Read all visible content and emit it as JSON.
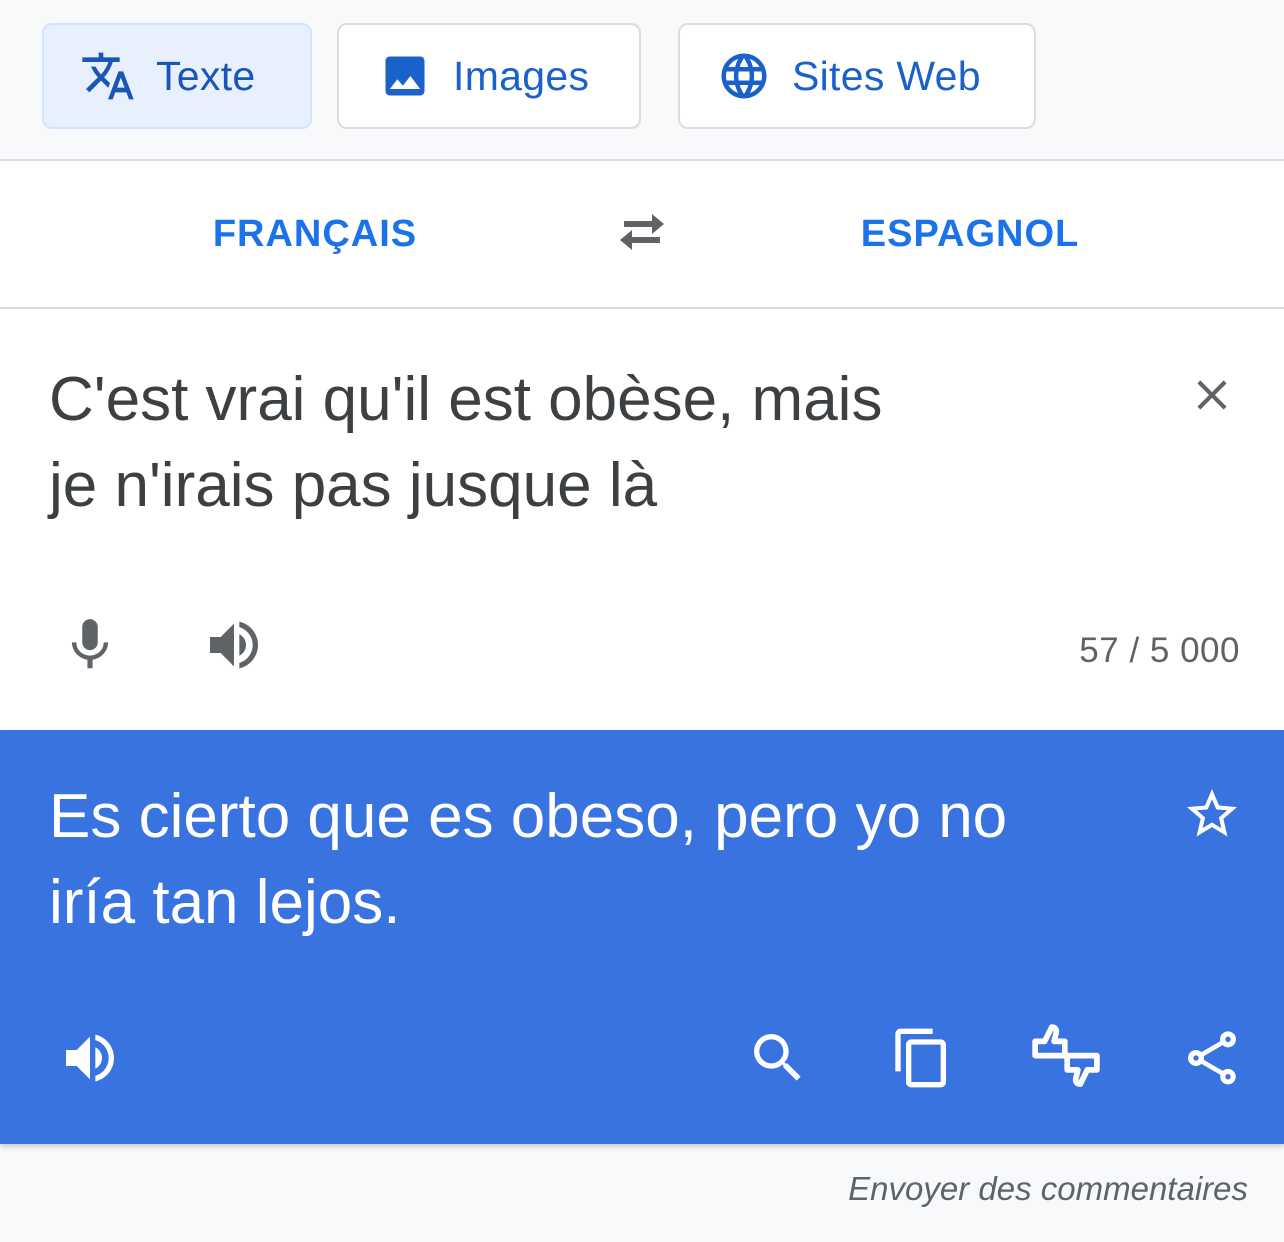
{
  "modes": {
    "text": {
      "label": "Texte",
      "icon": "translate-icon",
      "active": true
    },
    "images": {
      "label": "Images",
      "icon": "image-icon"
    },
    "sites": {
      "label": "Sites Web",
      "icon": "globe-icon"
    }
  },
  "languages": {
    "source": "FRANÇAIS",
    "target": "ESPAGNOL",
    "swap_icon": "swap-arrows-icon"
  },
  "source": {
    "line1": "C'est vrai qu'il est obèse, mais",
    "line2": "je n'irais pas jusque là",
    "char_count": "57 / 5 000",
    "icons": [
      "close-icon",
      "microphone-icon",
      "speaker-icon"
    ]
  },
  "translation": {
    "line1": "Es cierto que es obeso, pero yo no",
    "line2": "iría tan lejos.",
    "icons": [
      "star-icon",
      "speaker-icon",
      "search-icon",
      "copy-icon",
      "rate-translation-icon",
      "share-icon"
    ]
  },
  "footer": {
    "feedback": "Envoyer des commentaires"
  },
  "colors": {
    "accent": "#1a73e8",
    "translation_bg": "#3873e0",
    "active_tab_bg": "#e8f0fe",
    "text_dark": "#3c4043",
    "text_muted": "#5f6368"
  }
}
